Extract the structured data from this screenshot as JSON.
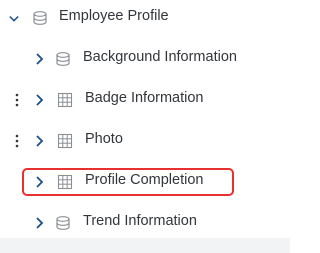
{
  "tree": {
    "root": {
      "label": "Employee Profile",
      "icon": "database-icon",
      "expanded": true
    },
    "children": [
      {
        "label": "Background Information",
        "icon": "database-icon",
        "draggable": false,
        "highlighted": false
      },
      {
        "label": "Badge Information",
        "icon": "table-grid-icon",
        "draggable": true,
        "highlighted": false
      },
      {
        "label": "Photo",
        "icon": "table-grid-icon",
        "draggable": true,
        "highlighted": false
      },
      {
        "label": "Profile Completion",
        "icon": "table-grid-icon",
        "draggable": false,
        "highlighted": true
      },
      {
        "label": "Trend Information",
        "icon": "database-icon",
        "draggable": false,
        "highlighted": false
      }
    ]
  },
  "colors": {
    "chevron": "#1a4f8b",
    "icon": "#8a8f94",
    "text": "#32363a",
    "highlight_border": "#e8312e",
    "bottom_band": "#f1f3f5"
  }
}
